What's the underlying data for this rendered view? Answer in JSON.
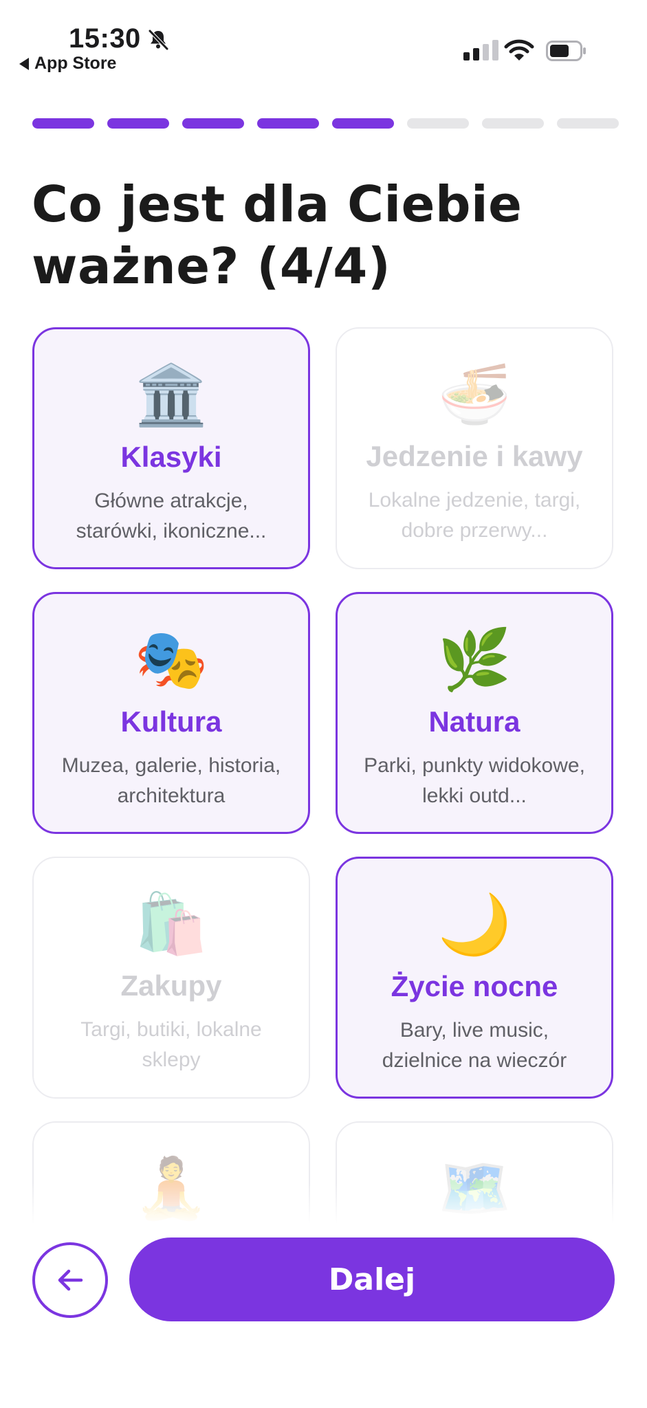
{
  "status_bar": {
    "time": "15:30",
    "back_app": "App Store"
  },
  "progress": {
    "total_steps": 8,
    "completed_steps": 5,
    "active_color": "#7b35e0",
    "inactive_color": "#e6e6e8"
  },
  "title": "Co jest dla Ciebie ważne? (4/4)",
  "options": [
    {
      "emoji": "🏛️",
      "icon": "classical-building-icon",
      "name": "Klasyki",
      "desc": "Główne atrakcje, starówki, ikoniczne...",
      "selected": true
    },
    {
      "emoji": "🍜",
      "icon": "noodle-bowl-icon",
      "name": "Jedzenie i kawy",
      "desc": "Lokalne jedzenie, targi, dobre przerwy...",
      "selected": false
    },
    {
      "emoji": "🎭",
      "icon": "theater-masks-icon",
      "name": "Kultura",
      "desc": "Muzea, galerie, historia, architektura",
      "selected": true
    },
    {
      "emoji": "🌿",
      "icon": "herb-icon",
      "name": "Natura",
      "desc": "Parki, punkty widokowe, lekki outd...",
      "selected": true
    },
    {
      "emoji": "🛍️",
      "icon": "shopping-bags-icon",
      "name": "Zakupy",
      "desc": "Targi, butiki, lokalne sklepy",
      "selected": false
    },
    {
      "emoji": "🌙",
      "icon": "crescent-moon-icon",
      "name": "Życie nocne",
      "desc": "Bary, live music, dzielnice na wieczór",
      "selected": true
    },
    {
      "emoji": "🧘",
      "icon": "meditation-icon",
      "name": "",
      "desc": "",
      "selected": false
    },
    {
      "emoji": "🗺️",
      "icon": "world-map-icon",
      "name": "",
      "desc": "",
      "selected": false
    }
  ],
  "footer": {
    "back_icon": "arrow-left-icon",
    "next_label": "Dalej"
  }
}
